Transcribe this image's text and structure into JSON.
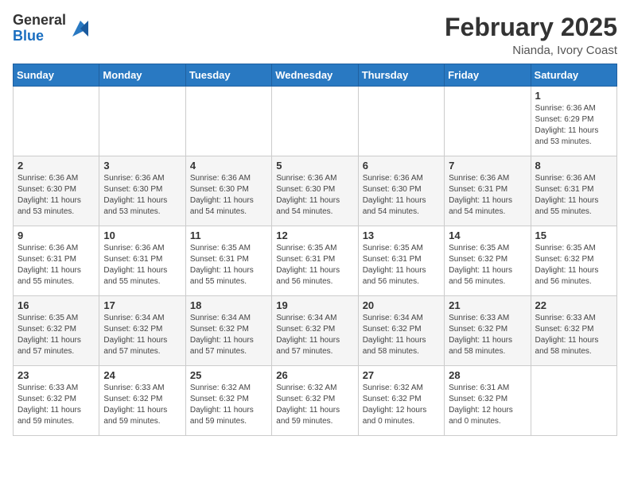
{
  "logo": {
    "general": "General",
    "blue": "Blue"
  },
  "header": {
    "title": "February 2025",
    "subtitle": "Nianda, Ivory Coast"
  },
  "weekdays": [
    "Sunday",
    "Monday",
    "Tuesday",
    "Wednesday",
    "Thursday",
    "Friday",
    "Saturday"
  ],
  "weeks": [
    [
      {
        "day": "",
        "sunrise": "",
        "sunset": "",
        "daylight": ""
      },
      {
        "day": "",
        "sunrise": "",
        "sunset": "",
        "daylight": ""
      },
      {
        "day": "",
        "sunrise": "",
        "sunset": "",
        "daylight": ""
      },
      {
        "day": "",
        "sunrise": "",
        "sunset": "",
        "daylight": ""
      },
      {
        "day": "",
        "sunrise": "",
        "sunset": "",
        "daylight": ""
      },
      {
        "day": "",
        "sunrise": "",
        "sunset": "",
        "daylight": ""
      },
      {
        "day": "1",
        "sunrise": "Sunrise: 6:36 AM",
        "sunset": "Sunset: 6:29 PM",
        "daylight": "Daylight: 11 hours and 53 minutes."
      }
    ],
    [
      {
        "day": "2",
        "sunrise": "Sunrise: 6:36 AM",
        "sunset": "Sunset: 6:30 PM",
        "daylight": "Daylight: 11 hours and 53 minutes."
      },
      {
        "day": "3",
        "sunrise": "Sunrise: 6:36 AM",
        "sunset": "Sunset: 6:30 PM",
        "daylight": "Daylight: 11 hours and 53 minutes."
      },
      {
        "day": "4",
        "sunrise": "Sunrise: 6:36 AM",
        "sunset": "Sunset: 6:30 PM",
        "daylight": "Daylight: 11 hours and 54 minutes."
      },
      {
        "day": "5",
        "sunrise": "Sunrise: 6:36 AM",
        "sunset": "Sunset: 6:30 PM",
        "daylight": "Daylight: 11 hours and 54 minutes."
      },
      {
        "day": "6",
        "sunrise": "Sunrise: 6:36 AM",
        "sunset": "Sunset: 6:30 PM",
        "daylight": "Daylight: 11 hours and 54 minutes."
      },
      {
        "day": "7",
        "sunrise": "Sunrise: 6:36 AM",
        "sunset": "Sunset: 6:31 PM",
        "daylight": "Daylight: 11 hours and 54 minutes."
      },
      {
        "day": "8",
        "sunrise": "Sunrise: 6:36 AM",
        "sunset": "Sunset: 6:31 PM",
        "daylight": "Daylight: 11 hours and 55 minutes."
      }
    ],
    [
      {
        "day": "9",
        "sunrise": "Sunrise: 6:36 AM",
        "sunset": "Sunset: 6:31 PM",
        "daylight": "Daylight: 11 hours and 55 minutes."
      },
      {
        "day": "10",
        "sunrise": "Sunrise: 6:36 AM",
        "sunset": "Sunset: 6:31 PM",
        "daylight": "Daylight: 11 hours and 55 minutes."
      },
      {
        "day": "11",
        "sunrise": "Sunrise: 6:35 AM",
        "sunset": "Sunset: 6:31 PM",
        "daylight": "Daylight: 11 hours and 55 minutes."
      },
      {
        "day": "12",
        "sunrise": "Sunrise: 6:35 AM",
        "sunset": "Sunset: 6:31 PM",
        "daylight": "Daylight: 11 hours and 56 minutes."
      },
      {
        "day": "13",
        "sunrise": "Sunrise: 6:35 AM",
        "sunset": "Sunset: 6:31 PM",
        "daylight": "Daylight: 11 hours and 56 minutes."
      },
      {
        "day": "14",
        "sunrise": "Sunrise: 6:35 AM",
        "sunset": "Sunset: 6:32 PM",
        "daylight": "Daylight: 11 hours and 56 minutes."
      },
      {
        "day": "15",
        "sunrise": "Sunrise: 6:35 AM",
        "sunset": "Sunset: 6:32 PM",
        "daylight": "Daylight: 11 hours and 56 minutes."
      }
    ],
    [
      {
        "day": "16",
        "sunrise": "Sunrise: 6:35 AM",
        "sunset": "Sunset: 6:32 PM",
        "daylight": "Daylight: 11 hours and 57 minutes."
      },
      {
        "day": "17",
        "sunrise": "Sunrise: 6:34 AM",
        "sunset": "Sunset: 6:32 PM",
        "daylight": "Daylight: 11 hours and 57 minutes."
      },
      {
        "day": "18",
        "sunrise": "Sunrise: 6:34 AM",
        "sunset": "Sunset: 6:32 PM",
        "daylight": "Daylight: 11 hours and 57 minutes."
      },
      {
        "day": "19",
        "sunrise": "Sunrise: 6:34 AM",
        "sunset": "Sunset: 6:32 PM",
        "daylight": "Daylight: 11 hours and 57 minutes."
      },
      {
        "day": "20",
        "sunrise": "Sunrise: 6:34 AM",
        "sunset": "Sunset: 6:32 PM",
        "daylight": "Daylight: 11 hours and 58 minutes."
      },
      {
        "day": "21",
        "sunrise": "Sunrise: 6:33 AM",
        "sunset": "Sunset: 6:32 PM",
        "daylight": "Daylight: 11 hours and 58 minutes."
      },
      {
        "day": "22",
        "sunrise": "Sunrise: 6:33 AM",
        "sunset": "Sunset: 6:32 PM",
        "daylight": "Daylight: 11 hours and 58 minutes."
      }
    ],
    [
      {
        "day": "23",
        "sunrise": "Sunrise: 6:33 AM",
        "sunset": "Sunset: 6:32 PM",
        "daylight": "Daylight: 11 hours and 59 minutes."
      },
      {
        "day": "24",
        "sunrise": "Sunrise: 6:33 AM",
        "sunset": "Sunset: 6:32 PM",
        "daylight": "Daylight: 11 hours and 59 minutes."
      },
      {
        "day": "25",
        "sunrise": "Sunrise: 6:32 AM",
        "sunset": "Sunset: 6:32 PM",
        "daylight": "Daylight: 11 hours and 59 minutes."
      },
      {
        "day": "26",
        "sunrise": "Sunrise: 6:32 AM",
        "sunset": "Sunset: 6:32 PM",
        "daylight": "Daylight: 11 hours and 59 minutes."
      },
      {
        "day": "27",
        "sunrise": "Sunrise: 6:32 AM",
        "sunset": "Sunset: 6:32 PM",
        "daylight": "Daylight: 12 hours and 0 minutes."
      },
      {
        "day": "28",
        "sunrise": "Sunrise: 6:31 AM",
        "sunset": "Sunset: 6:32 PM",
        "daylight": "Daylight: 12 hours and 0 minutes."
      },
      {
        "day": "",
        "sunrise": "",
        "sunset": "",
        "daylight": ""
      }
    ]
  ]
}
